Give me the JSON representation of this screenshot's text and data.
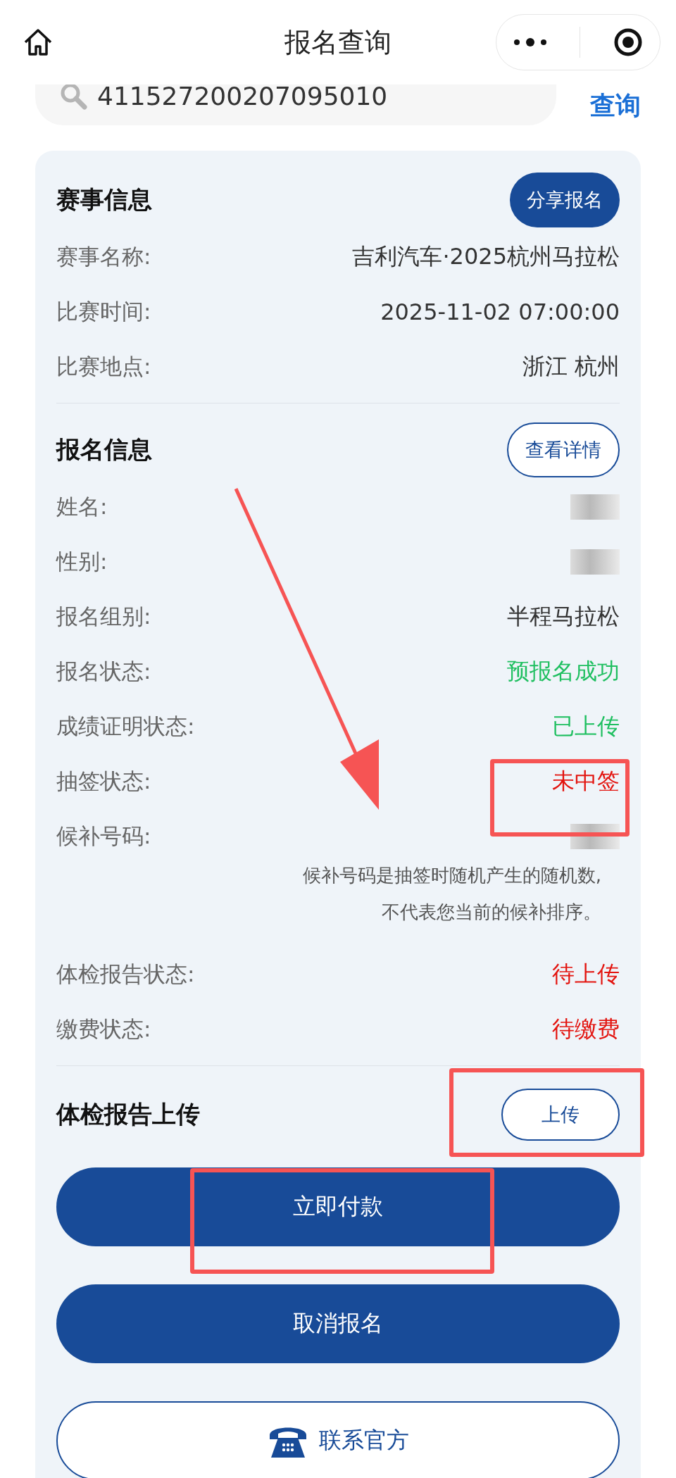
{
  "nav_bar": {
    "title": "报名查询"
  },
  "search": {
    "value": "411527200207095010",
    "button": "查询"
  },
  "event_info": {
    "title": "赛事信息",
    "action": "分享报名",
    "rows": [
      {
        "label": "赛事名称:",
        "value": "吉利汽车·2025杭州马拉松",
        "kind": "text"
      },
      {
        "label": "比赛时间:",
        "value": "2025-11-02 07:00:00",
        "kind": "text"
      },
      {
        "label": "比赛地点:",
        "value": "浙江 杭州",
        "kind": "text"
      }
    ]
  },
  "registration_info": {
    "title": "报名信息",
    "action": "查看详情",
    "rows": [
      {
        "label": "姓名:",
        "kind": "redacted"
      },
      {
        "label": "性别:",
        "kind": "redacted"
      },
      {
        "label": "报名组别:",
        "value": "半程马拉松",
        "kind": "text"
      },
      {
        "label": "报名状态:",
        "value": "预报名成功",
        "kind": "text",
        "color": "#1fbf60"
      },
      {
        "label": "成绩证明状态:",
        "value": "已上传",
        "kind": "text",
        "color": "#1fbf60"
      },
      {
        "label": "抽签状态:",
        "value": "未中签",
        "kind": "text",
        "color": "#e3140f"
      },
      {
        "label": "候补号码:",
        "kind": "redacted",
        "note": [
          "候补号码是抽签时随机产生的随机数,",
          "不代表您当前的候补排序。"
        ]
      },
      {
        "label": "体检报告状态:",
        "value": "待上传",
        "kind": "text",
        "color": "#e3140f"
      },
      {
        "label": "缴费状态:",
        "value": "待缴费",
        "kind": "text",
        "color": "#e3140f"
      }
    ]
  },
  "upload": {
    "title": "体检报告上传",
    "button": "上传"
  },
  "buttons": [
    {
      "label": "立即付款",
      "kind": "primary"
    },
    {
      "label": "取消报名",
      "kind": "primary"
    },
    {
      "label": "联系官方",
      "kind": "outline"
    }
  ]
}
